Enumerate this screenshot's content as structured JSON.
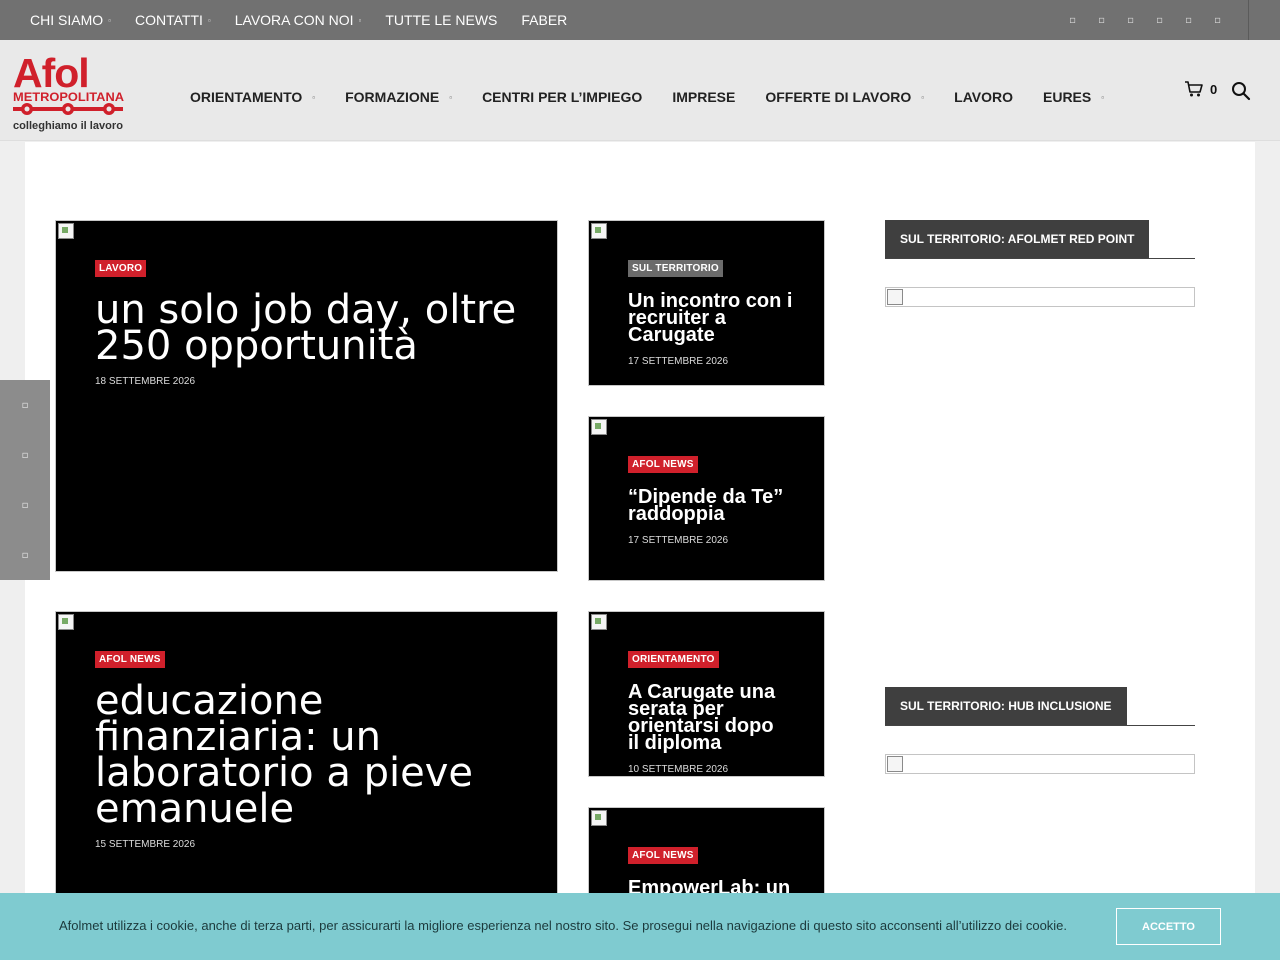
{
  "topbar": {
    "items": [
      {
        "label": "CHI SIAMO",
        "has_submenu": true
      },
      {
        "label": "CONTATTI",
        "has_submenu": true
      },
      {
        "label": "LAVORA CON NOI",
        "has_submenu": true
      },
      {
        "label": "TUTTE LE NEWS",
        "has_submenu": false
      },
      {
        "label": "FABER",
        "has_submenu": false
      }
    ],
    "submenu_glyph": "▫",
    "social_glyph": "▫",
    "social_icons": [
      "facebook-icon",
      "twitter-icon",
      "linkedin-icon",
      "instagram-icon",
      "youtube-icon",
      "telegram-icon"
    ]
  },
  "header": {
    "logo": {
      "word": "Afol",
      "line2": "METROPOLITANA",
      "tagline": "colleghiamo il lavoro"
    },
    "nav": [
      {
        "label": "ORIENTAMENTO",
        "has_submenu": true
      },
      {
        "label": "FORMAZIONE",
        "has_submenu": true
      },
      {
        "label": "CENTRI PER L’IMPIEGO",
        "has_submenu": false
      },
      {
        "label": "IMPRESE",
        "has_submenu": false
      },
      {
        "label": "OFFERTE DI LAVORO",
        "has_submenu": true
      },
      {
        "label": "LAVORO",
        "has_submenu": false
      },
      {
        "label": "EURES",
        "has_submenu": true
      }
    ],
    "cart_count": "0",
    "icons": [
      "cart-icon",
      "search-icon"
    ]
  },
  "articles": {
    "big": [
      {
        "tag": "LAVORO",
        "title_lines": [
          "un solo job day, oltre",
          "250 opportunità"
        ],
        "date": "18 SETTEMBRE 2026"
      },
      {
        "tag": "AFOL NEWS",
        "title_lines": [
          "educazione",
          "finanziaria: un",
          "laboratorio a pieve",
          "emanuele"
        ],
        "date": "15 SETTEMBRE 2026"
      }
    ],
    "small": [
      {
        "tag": "SUL TERRITORIO",
        "title_lines": [
          "Un incontro con i",
          "recruiter a",
          "Carugate"
        ],
        "date": "17 SETTEMBRE 2026"
      },
      {
        "tag": "AFOL NEWS",
        "title_lines": [
          "“Dipende da Te”",
          "raddoppia"
        ],
        "date": "17 SETTEMBRE 2026"
      },
      {
        "tag": "ORIENTAMENTO",
        "title_lines": [
          "A Carugate una",
          "serata per",
          "orientarsi dopo",
          "il diploma"
        ],
        "date": "10 SETTEMBRE 2026"
      },
      {
        "tag": "AFOL NEWS",
        "title_lines": [
          "EmpowerLab: un"
        ],
        "date": ""
      }
    ]
  },
  "sidebar": {
    "widgets": [
      {
        "title": "SUL TERRITORIO: AFOLMET RED POINT"
      },
      {
        "title": "SUL TERRITORIO: HUB INCLUSIONE"
      }
    ]
  },
  "share_bar": {
    "glyph": "▫",
    "icons": [
      "facebook-share-icon",
      "twitter-share-icon",
      "linkedin-share-icon",
      "email-share-icon"
    ]
  },
  "cookie": {
    "text": "Afolmet utilizza i cookie, anche di terza parti, per assicurarti la migliore esperienza nel nostro sito. Se prosegui nella navigazione di questo sito acconsenti all’utilizzo dei cookie.",
    "accept_label": "ACCETTO"
  },
  "colors": {
    "brand_red": "#d0202b",
    "topbar": "#717171",
    "cookie_bar": "#7fcbd0"
  }
}
